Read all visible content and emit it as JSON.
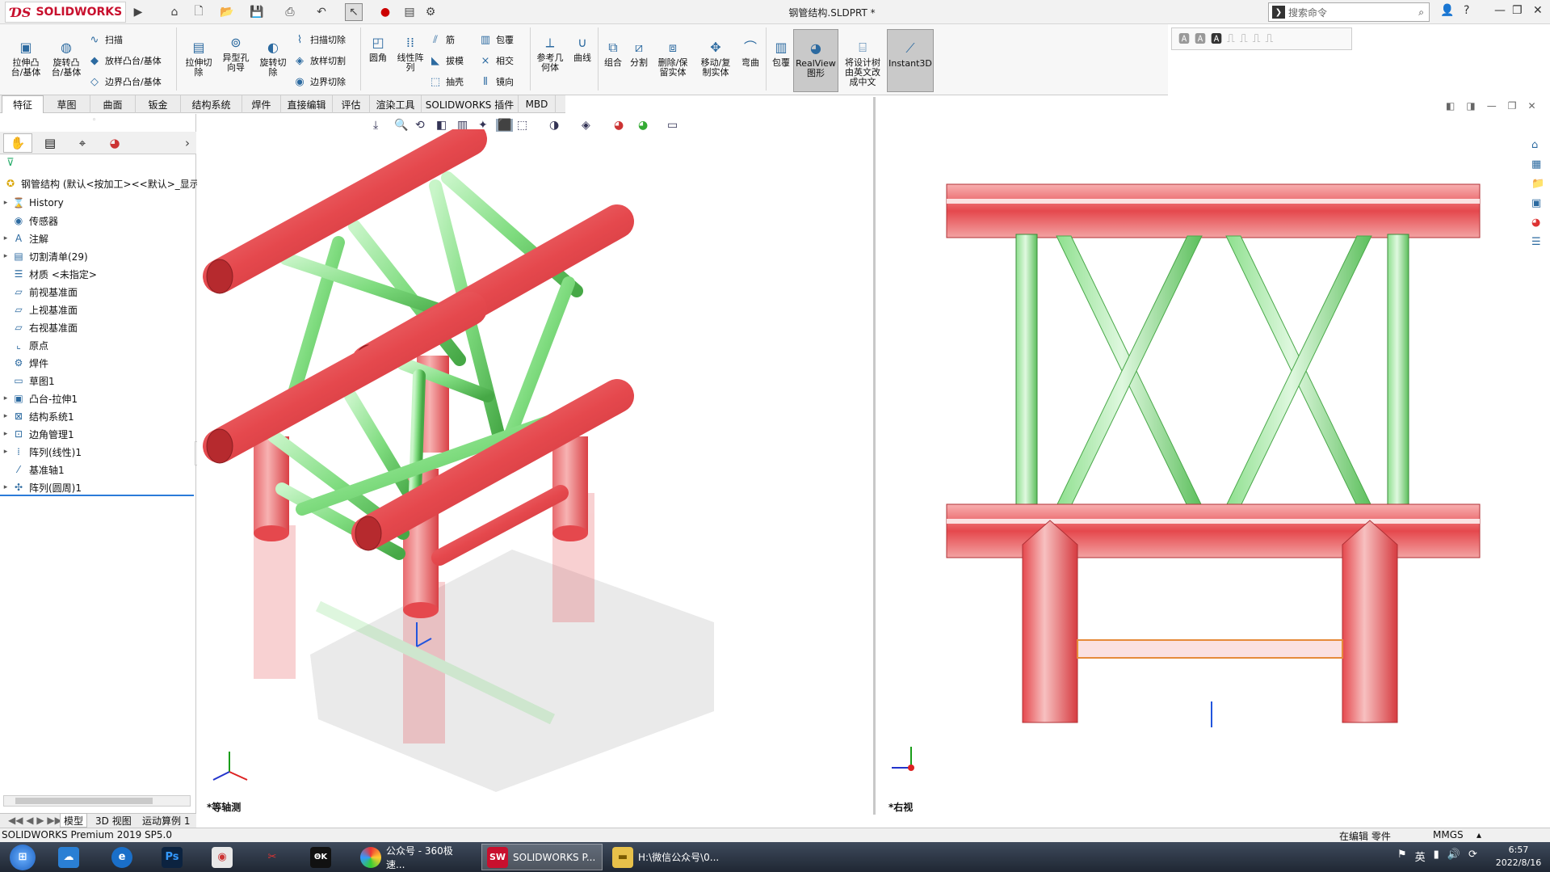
{
  "app": {
    "brand": "SOLIDWORKS",
    "document_title": "钢管结构.SLDPRT *",
    "search_placeholder": "搜索命令"
  },
  "quick_access": [
    "home-icon",
    "new-icon",
    "open-icon",
    "save-icon",
    "print-icon",
    "undo-icon",
    "select-icon",
    "traffic-light-icon",
    "options-icon"
  ],
  "ribbon": {
    "large_buttons": [
      {
        "label": "拉伸凸\n台/基体",
        "icon": "extrude-boss-icon"
      },
      {
        "label": "旋转凸\n台/基体",
        "icon": "revolve-boss-icon"
      },
      {
        "label": "拉伸切\n除",
        "icon": "extrude-cut-icon"
      },
      {
        "label": "异型孔\n向导",
        "icon": "hole-wizard-icon"
      },
      {
        "label": "旋转切\n除",
        "icon": "revolve-cut-icon"
      },
      {
        "label": "圆角",
        "icon": "fillet-icon"
      },
      {
        "label": "线性阵\n列",
        "icon": "linear-pattern-icon"
      },
      {
        "label": "参考几\n何体",
        "icon": "reference-geometry-icon"
      },
      {
        "label": "曲线",
        "icon": "curves-icon"
      },
      {
        "label": "组合",
        "icon": "combine-icon"
      },
      {
        "label": "分割",
        "icon": "split-icon"
      },
      {
        "label": "删除/保\n留实体",
        "icon": "delete-keep-body-icon"
      },
      {
        "label": "移动/复\n制实体",
        "icon": "move-copy-body-icon"
      },
      {
        "label": "弯曲",
        "icon": "flex-icon"
      },
      {
        "label": "包覆",
        "icon": "wrap-icon"
      },
      {
        "label": "RealView\n图形",
        "icon": "realview-icon"
      },
      {
        "label": "将设计树\n由英文改\n成中文",
        "icon": "design-tree-icon"
      },
      {
        "label": "Instant3D",
        "icon": "instant3d-icon"
      }
    ],
    "small_buttons": [
      {
        "label": "扫描",
        "icon": "sweep-icon"
      },
      {
        "label": "放样凸台/基体",
        "icon": "loft-icon"
      },
      {
        "label": "边界凸台/基体",
        "icon": "boundary-boss-icon"
      },
      {
        "label": "扫描切除",
        "icon": "swept-cut-icon"
      },
      {
        "label": "放样切割",
        "icon": "lofted-cut-icon"
      },
      {
        "label": "边界切除",
        "icon": "boundary-cut-icon"
      },
      {
        "label": "筋",
        "icon": "rib-icon"
      },
      {
        "label": "拔模",
        "icon": "draft-icon"
      },
      {
        "label": "抽壳",
        "icon": "shell-icon"
      },
      {
        "label": "包覆",
        "icon": "wrap-small-icon"
      },
      {
        "label": "相交",
        "icon": "intersect-icon"
      },
      {
        "label": "镜向",
        "icon": "mirror-icon"
      }
    ]
  },
  "tabs": [
    "特征",
    "草图",
    "曲面",
    "钣金",
    "结构系统",
    "焊件",
    "直接编辑",
    "评估",
    "渲染工具",
    "SOLIDWORKS 插件",
    "MBD"
  ],
  "tree": {
    "root": "钢管结构 (默认<按加工><<默认>_显示",
    "items": [
      {
        "label": "History",
        "icon": "history-icon",
        "expandable": true
      },
      {
        "label": "传感器",
        "icon": "sensor-icon",
        "expandable": false
      },
      {
        "label": "注解",
        "icon": "annotation-icon",
        "expandable": true
      },
      {
        "label": "切割清单(29)",
        "icon": "cut-list-icon",
        "expandable": true
      },
      {
        "label": "材质 <未指定>",
        "icon": "material-icon",
        "expandable": false
      },
      {
        "label": "前视基准面",
        "icon": "plane-icon",
        "expandable": false
      },
      {
        "label": "上视基准面",
        "icon": "plane-icon",
        "expandable": false
      },
      {
        "label": "右视基准面",
        "icon": "plane-icon",
        "expandable": false
      },
      {
        "label": "原点",
        "icon": "origin-icon",
        "expandable": false
      },
      {
        "label": "焊件",
        "icon": "weldment-icon",
        "expandable": false
      },
      {
        "label": "草图1",
        "icon": "sketch-icon",
        "expandable": false
      },
      {
        "label": "凸台-拉伸1",
        "icon": "extrude-icon",
        "expandable": true
      },
      {
        "label": "结构系统1",
        "icon": "structure-system-icon",
        "expandable": true
      },
      {
        "label": "边角管理1",
        "icon": "corner-icon",
        "expandable": true
      },
      {
        "label": "阵列(线性)1",
        "icon": "linear-pattern-icon",
        "expandable": true
      },
      {
        "label": "基准轴1",
        "icon": "axis-icon",
        "expandable": false
      },
      {
        "label": "阵列(圆周)1",
        "icon": "circular-pattern-icon",
        "expandable": true
      }
    ]
  },
  "bottom_tabs": [
    "模型",
    "3D 视图",
    "运动算例 1"
  ],
  "views": {
    "left_label": "*等轴测",
    "right_label": "*右视"
  },
  "status": {
    "left": "SOLIDWORKS Premium 2019 SP5.0",
    "edit": "在编辑 零件",
    "units": "MMGS"
  },
  "taskbar": {
    "items": [
      {
        "label": "公众号 - 360极速...",
        "icon": "360-browser-icon",
        "active": false
      },
      {
        "label": "SOLIDWORKS P...",
        "icon": "solidworks-icon",
        "active": true
      },
      {
        "label": "H:\\微信公众号\\0...",
        "icon": "folder-icon",
        "active": false
      }
    ],
    "time": "6:57",
    "date": "2022/8/16"
  },
  "colors": {
    "tube_red": "#e5484d",
    "tube_green": "#7fdc7f",
    "accent": "#c8102e"
  }
}
